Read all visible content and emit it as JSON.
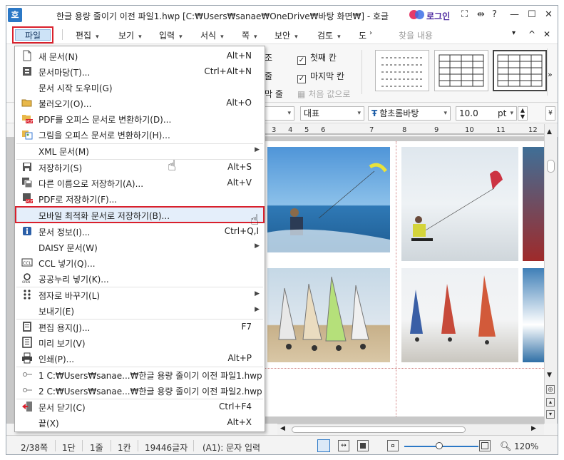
{
  "window": {
    "title": "한글 용량 줄이기 이전 파일1.hwp [C:₩Users₩sanae₩OneDrive₩바탕 화면₩] - 호글",
    "app_icon_label": "호",
    "login_label": "로그인",
    "controls": {
      "fullscreen": "⛶",
      "split": "⇹",
      "help": "?",
      "minimize": "—",
      "maximize": "☐",
      "close": "✕"
    }
  },
  "menubar": {
    "file": "파일",
    "items": [
      "편집",
      "보기",
      "입력",
      "서식",
      "쪽",
      "보안",
      "검토",
      "도"
    ],
    "search_placeholder": "찾을 내용",
    "ribbon_toggle": "^",
    "close_doc": "✕"
  },
  "ribbon": {
    "partial_labels": [
      "조",
      "줄",
      "막 줄"
    ],
    "first_col": "첫째 칸",
    "last_col": "마지막 칸",
    "reset": "처음 값으로",
    "more": "»"
  },
  "formatbar": {
    "style": "대표",
    "font": "함초롬바탕",
    "size": "10.0",
    "unit": "pt"
  },
  "ruler": {
    "numbers": [
      "3",
      "4",
      "5",
      "6",
      "7",
      "8",
      "9",
      "10",
      "11",
      "12"
    ]
  },
  "file_menu": {
    "items": [
      {
        "label": "새 문서(N)",
        "shortcut": "Alt+N",
        "icon": "new-document-icon"
      },
      {
        "label": "문서마당(T)...",
        "shortcut": "Ctrl+Alt+N",
        "icon": "template-icon"
      },
      {
        "label": "문서 시작 도우미(G)",
        "shortcut": "",
        "icon": ""
      },
      {
        "label": "불러오기(O)...",
        "shortcut": "Alt+O",
        "icon": "open-folder-icon"
      },
      {
        "label": "PDF를 오피스 문서로 변환하기(D)...",
        "shortcut": "",
        "icon": "pdf-convert-icon"
      },
      {
        "label": "그림을 오피스 문서로 변환하기(H)...",
        "shortcut": "",
        "icon": "image-convert-icon"
      },
      {
        "label": "XML 문서(M)",
        "shortcut": "",
        "icon": "",
        "submenu": true
      },
      {
        "label": "저장하기(S)",
        "shortcut": "Alt+S",
        "icon": "save-icon"
      },
      {
        "label": "다른 이름으로 저장하기(A)...",
        "shortcut": "Alt+V",
        "icon": "save-as-icon"
      },
      {
        "label": "PDF로 저장하기(F)...",
        "shortcut": "",
        "icon": "save-pdf-icon"
      },
      {
        "label": "모바일 최적화 문서로 저장하기(B)...",
        "shortcut": "",
        "icon": "",
        "highlight": true
      },
      {
        "label": "문서 정보(I)...",
        "shortcut": "Ctrl+Q,I",
        "icon": "info-icon"
      },
      {
        "label": "DAISY 문서(W)",
        "shortcut": "",
        "icon": "",
        "submenu": true
      },
      {
        "label": "CCL 넣기(Q)...",
        "shortcut": "",
        "icon": "ccl-icon"
      },
      {
        "label": "공공누리 넣기(K)...",
        "shortcut": "",
        "icon": "open-license-icon"
      },
      {
        "label": "점자로 바꾸기(L)",
        "shortcut": "",
        "icon": "braille-icon",
        "submenu": true
      },
      {
        "label": "보내기(E)",
        "shortcut": "",
        "icon": "",
        "submenu": true
      },
      {
        "label": "편집 용지(J)...",
        "shortcut": "F7",
        "icon": "page-setup-icon"
      },
      {
        "label": "미리 보기(V)",
        "shortcut": "",
        "icon": "preview-icon"
      },
      {
        "label": "인쇄(P)...",
        "shortcut": "Alt+P",
        "icon": "print-icon"
      },
      {
        "label": "1 C:₩Users₩sanae...₩한글 용량 줄이기 이전 파일1.hwp",
        "shortcut": "",
        "icon": "pin-icon"
      },
      {
        "label": "2 C:₩Users₩sanae...₩한글 용량 줄이기 이전 파일2.hwp",
        "shortcut": "",
        "icon": "pin-icon"
      },
      {
        "label": "문서 닫기(C)",
        "shortcut": "Ctrl+F4",
        "icon": "close-document-icon"
      },
      {
        "label": "끝(X)",
        "shortcut": "Alt+X",
        "icon": ""
      }
    ]
  },
  "statusbar": {
    "page": "2/38쪽",
    "section": "1단",
    "line": "1줄",
    "column": "1칸",
    "chars": "19446글자",
    "mode": "(A1): 문자 입력",
    "zoom": "120%"
  },
  "colors": {
    "accent_red": "#d9202c",
    "highlight_bg": "#e4eefa",
    "file_btn_bg": "#cde3f7"
  }
}
